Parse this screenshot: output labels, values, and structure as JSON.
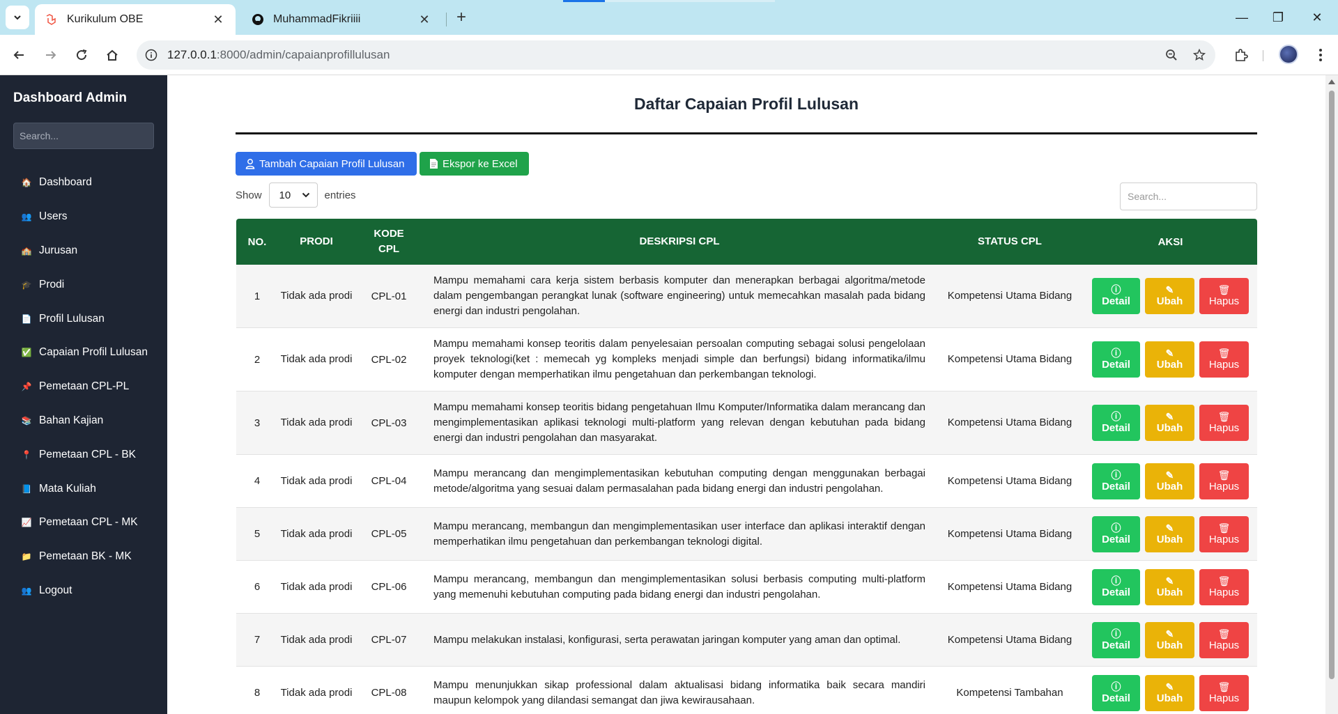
{
  "browser": {
    "tabs": [
      {
        "title": "Kurikulum OBE",
        "active": true,
        "icon": "laravel-icon"
      },
      {
        "title": "MuhammadFikriiii",
        "active": false,
        "icon": "github-icon"
      }
    ],
    "url_host": "127.0.0.1",
    "url_path": ":8000/admin/capaianprofillulusan"
  },
  "sidebar": {
    "title": "Dashboard Admin",
    "search_placeholder": "Search...",
    "items": [
      {
        "label": "Dashboard",
        "icon": "🏠"
      },
      {
        "label": "Users",
        "icon": "👥"
      },
      {
        "label": "Jurusan",
        "icon": "🏫"
      },
      {
        "label": "Prodi",
        "icon": "🎓"
      },
      {
        "label": "Profil Lulusan",
        "icon": "📄"
      },
      {
        "label": "Capaian Profil Lulusan",
        "icon": "✅"
      },
      {
        "label": "Pemetaan CPL-PL",
        "icon": "📌"
      },
      {
        "label": "Bahan Kajian",
        "icon": "📚"
      },
      {
        "label": "Pemetaan CPL - BK",
        "icon": "📍"
      },
      {
        "label": "Mata Kuliah",
        "icon": "📘"
      },
      {
        "label": "Pemetaan CPL - MK",
        "icon": "📈"
      },
      {
        "label": "Pemetaan BK - MK",
        "icon": "📁"
      },
      {
        "label": "Logout",
        "icon": "👥"
      }
    ]
  },
  "main": {
    "title": "Daftar Capaian Profil Lulusan",
    "add_button": "Tambah Capaian Profil Lulusan",
    "export_button": "Ekspor ke Excel",
    "show_label": "Show",
    "entries_value": "10",
    "entries_label": "entries",
    "search_placeholder": "Search...",
    "columns": [
      "NO.",
      "PRODI",
      "KODE CPL",
      "DESKRIPSI CPL",
      "STATUS CPL",
      "AKSI"
    ],
    "action_labels": {
      "detail": "Detail",
      "ubah": "Ubah",
      "hapus": "Hapus"
    },
    "rows": [
      {
        "no": "1",
        "prodi": "Tidak ada prodi",
        "kode": "CPL-01",
        "deskripsi": "Mampu memahami cara kerja sistem berbasis komputer dan menerapkan berbagai algoritma/metode dalam pengembangan perangkat lunak (software engineering) untuk memecahkan masalah pada bidang energi dan industri pengolahan.",
        "status": "Kompetensi Utama Bidang"
      },
      {
        "no": "2",
        "prodi": "Tidak ada prodi",
        "kode": "CPL-02",
        "deskripsi": "Mampu memahami konsep teoritis dalam penyelesaian persoalan computing sebagai solusi pengelolaan proyek teknologi(ket : memecah yg kompleks menjadi simple dan berfungsi) bidang informatika/ilmu komputer dengan memperhatikan ilmu pengetahuan dan perkembangan teknologi.",
        "status": "Kompetensi Utama Bidang"
      },
      {
        "no": "3",
        "prodi": "Tidak ada prodi",
        "kode": "CPL-03",
        "deskripsi": "Mampu memahami konsep teoritis bidang pengetahuan Ilmu Komputer/Informatika dalam merancang dan mengimplementasikan aplikasi teknologi multi-platform yang relevan dengan kebutuhan pada bidang energi dan industri pengolahan dan masyarakat.",
        "status": "Kompetensi Utama Bidang"
      },
      {
        "no": "4",
        "prodi": "Tidak ada prodi",
        "kode": "CPL-04",
        "deskripsi": "Mampu merancang dan mengimplementasikan kebutuhan computing dengan menggunakan berbagai metode/algoritma yang sesuai dalam permasalahan pada bidang energi dan industri pengolahan.",
        "status": "Kompetensi Utama Bidang"
      },
      {
        "no": "5",
        "prodi": "Tidak ada prodi",
        "kode": "CPL-05",
        "deskripsi": "Mampu merancang, membangun dan mengimplementasikan user interface dan aplikasi interaktif dengan memperhatikan ilmu pengetahuan dan perkembangan teknologi digital.",
        "status": "Kompetensi Utama Bidang"
      },
      {
        "no": "6",
        "prodi": "Tidak ada prodi",
        "kode": "CPL-06",
        "deskripsi": "Mampu merancang, membangun dan mengimplementasikan solusi berbasis computing multi-platform yang memenuhi kebutuhan computing pada bidang energi dan industri pengolahan.",
        "status": "Kompetensi Utama Bidang"
      },
      {
        "no": "7",
        "prodi": "Tidak ada prodi",
        "kode": "CPL-07",
        "deskripsi": "Mampu melakukan instalasi, konfigurasi, serta perawatan jaringan komputer yang aman dan optimal.",
        "status": "Kompetensi Utama Bidang"
      },
      {
        "no": "8",
        "prodi": "Tidak ada prodi",
        "kode": "CPL-08",
        "deskripsi": "Mampu menunjukkan sikap professional dalam aktualisasi bidang informatika baik secara mandiri maupun kelompok yang dilandasi semangat dan jiwa kewirausahaan.",
        "status": "Kompetensi Tambahan"
      }
    ]
  }
}
